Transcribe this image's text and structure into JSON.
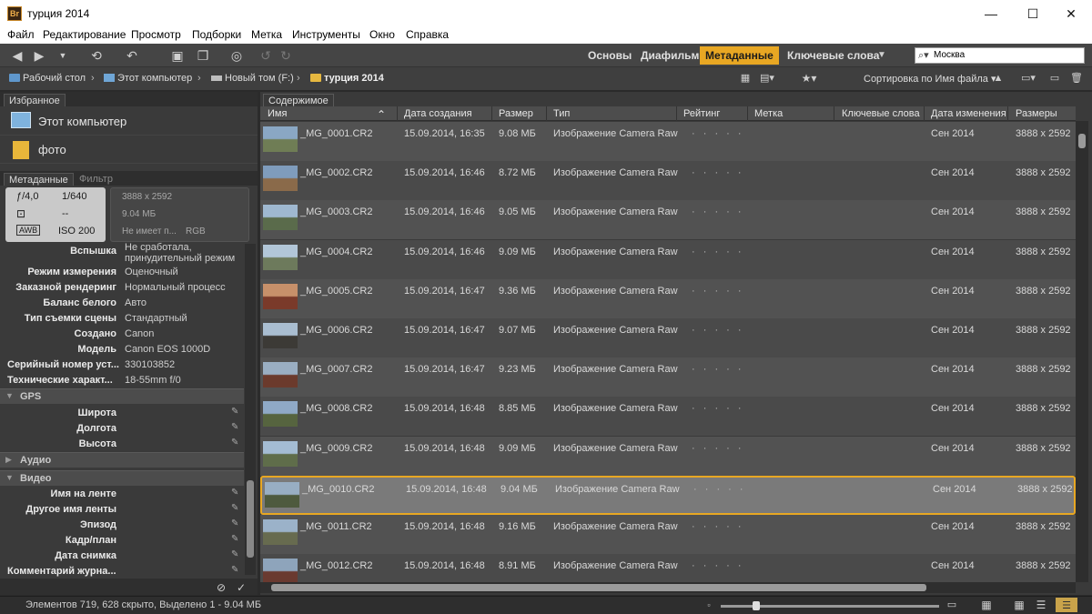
{
  "window": {
    "app_icon": "Br",
    "title": "турция 2014",
    "minimize": "—",
    "maximize": "☐",
    "close": "✕"
  },
  "menu": [
    "Файл",
    "Редактирование",
    "Просмотр",
    "Подборки",
    "Метка",
    "Инструменты",
    "Окно",
    "Справка"
  ],
  "workspaces": [
    {
      "label": "Основы",
      "active": false
    },
    {
      "label": "Диафильм",
      "active": false
    },
    {
      "label": "Метаданные",
      "active": true
    },
    {
      "label": "Ключевые слова",
      "active": false
    }
  ],
  "search": {
    "value": "Москва"
  },
  "breadcrumb": [
    "Рабочий стол",
    "Этот компьютер",
    "Новый том (F:)",
    "турция 2014"
  ],
  "sort": {
    "label": "Сортировка по Имя файла"
  },
  "favorites": {
    "tab_label": "Избранное",
    "items": [
      "Этот компьютер",
      "фото"
    ]
  },
  "metadata_panel": {
    "tabs": [
      "Метаданные",
      "Фильтр"
    ],
    "exif": {
      "aperture": "ƒ/4,0",
      "shutter": "1/640",
      "metering_value": "--",
      "wb": "AWB",
      "iso": "ISO 200"
    },
    "file_info": {
      "dimensions": "3888 x 2592",
      "size": "9.04 МБ",
      "profile": "Не имеет п...",
      "color_mode": "RGB"
    },
    "rows": [
      {
        "key": "Вспышка",
        "value": "Не сработала, принудительный режим"
      },
      {
        "key": "Режим измерения",
        "value": "Оценочный"
      },
      {
        "key": "Заказной рендеринг",
        "value": "Нормальный процесс"
      },
      {
        "key": "Баланс белого",
        "value": "Авто"
      },
      {
        "key": "Тип съемки сцены",
        "value": "Стандартный"
      },
      {
        "key": "Создано",
        "value": "Canon"
      },
      {
        "key": "Модель",
        "value": "Canon EOS 1000D"
      },
      {
        "key": "Серийный номер уст...",
        "value": "330103852"
      },
      {
        "key": "Технические характ...",
        "value": "18-55mm f/0"
      }
    ],
    "sections": {
      "gps": {
        "label": "GPS",
        "fields": [
          "Широта",
          "Долгота",
          "Высота"
        ]
      },
      "audio": {
        "label": "Аудио"
      },
      "video": {
        "label": "Видео",
        "fields": [
          "Имя на ленте",
          "Другое имя ленты",
          "Эпизод",
          "Кадр/план",
          "Дата снимка",
          "Комментарий журна..."
        ]
      }
    }
  },
  "content": {
    "tab_label": "Содержимое",
    "columns": [
      "Имя",
      "Дата создания",
      "Размер",
      "Тип",
      "Рейтинг",
      "Метка",
      "Ключевые слова",
      "Дата изменения",
      "Размеры"
    ],
    "files": [
      {
        "name": "_MG_0001.CR2",
        "created": "15.09.2014, 16:35",
        "size": "9.08 МБ",
        "type": "Изображение Camera Raw",
        "rating": "· · · · ·",
        "modified": "Сен 2014",
        "dims": "3888 x 2592",
        "thumb": [
          "#8aa7c4",
          "#6f7d55"
        ]
      },
      {
        "name": "_MG_0002.CR2",
        "created": "15.09.2014, 16:46",
        "size": "8.72 МБ",
        "type": "Изображение Camera Raw",
        "rating": "· · · · ·",
        "modified": "Сен 2014",
        "dims": "3888 x 2592",
        "thumb": [
          "#7f9cbc",
          "#8a6a4a"
        ]
      },
      {
        "name": "_MG_0003.CR2",
        "created": "15.09.2014, 16:46",
        "size": "9.05 МБ",
        "type": "Изображение Camera Raw",
        "rating": "· · · · ·",
        "modified": "Сен 2014",
        "dims": "3888 x 2592",
        "thumb": [
          "#9fb8d0",
          "#5a6b4b"
        ]
      },
      {
        "name": "_MG_0004.CR2",
        "created": "15.09.2014, 16:46",
        "size": "9.09 МБ",
        "type": "Изображение Camera Raw",
        "rating": "· · · · ·",
        "modified": "Сен 2014",
        "dims": "3888 x 2592",
        "thumb": [
          "#b2c6d8",
          "#6d7a5c"
        ]
      },
      {
        "name": "_MG_0005.CR2",
        "created": "15.09.2014, 16:47",
        "size": "9.36 МБ",
        "type": "Изображение Camera Raw",
        "rating": "· · · · ·",
        "modified": "Сен 2014",
        "dims": "3888 x 2592",
        "thumb": [
          "#c7906a",
          "#7a3a2a"
        ]
      },
      {
        "name": "_MG_0006.CR2",
        "created": "15.09.2014, 16:47",
        "size": "9.07 МБ",
        "type": "Изображение Camera Raw",
        "rating": "· · · · ·",
        "modified": "Сен 2014",
        "dims": "3888 x 2592",
        "thumb": [
          "#a9bdd0",
          "#3c3a36"
        ]
      },
      {
        "name": "_MG_0007.CR2",
        "created": "15.09.2014, 16:47",
        "size": "9.23 МБ",
        "type": "Изображение Camera Raw",
        "rating": "· · · · ·",
        "modified": "Сен 2014",
        "dims": "3888 x 2592",
        "thumb": [
          "#9aaec2",
          "#6b3a2c"
        ]
      },
      {
        "name": "_MG_0008.CR2",
        "created": "15.09.2014, 16:48",
        "size": "8.85 МБ",
        "type": "Изображение Camera Raw",
        "rating": "· · · · ·",
        "modified": "Сен 2014",
        "dims": "3888 x 2592",
        "thumb": [
          "#8fa9c6",
          "#56643f"
        ]
      },
      {
        "name": "_MG_0009.CR2",
        "created": "15.09.2014, 16:48",
        "size": "9.09 МБ",
        "type": "Изображение Camera Raw",
        "rating": "· · · · ·",
        "modified": "Сен 2014",
        "dims": "3888 x 2592",
        "thumb": [
          "#a4bcd3",
          "#5f6d4a"
        ]
      },
      {
        "name": "_MG_0010.CR2",
        "created": "15.09.2014, 16:48",
        "size": "9.04 МБ",
        "type": "Изображение Camera Raw",
        "rating": "· · · · ·",
        "modified": "Сен 2014",
        "dims": "3888 x 2592",
        "thumb": [
          "#98aec3",
          "#4e5a3e"
        ],
        "selected": true
      },
      {
        "name": "_MG_0011.CR2",
        "created": "15.09.2014, 16:48",
        "size": "9.16 МБ",
        "type": "Изображение Camera Raw",
        "rating": "· · · · ·",
        "modified": "Сен 2014",
        "dims": "3888 x 2592",
        "thumb": [
          "#9bb2c9",
          "#676b4f"
        ]
      },
      {
        "name": "_MG_0012.CR2",
        "created": "15.09.2014, 16:48",
        "size": "8.91 МБ",
        "type": "Изображение Camera Raw",
        "rating": "· · · · ·",
        "modified": "Сен 2014",
        "dims": "3888 x 2592",
        "thumb": [
          "#8ea4bb",
          "#6a3a30"
        ]
      }
    ]
  },
  "status": {
    "text": "Элементов 719, 628 скрыто, Выделено 1 - 9.04 МБ"
  },
  "colors": {
    "accent": "#e8a723",
    "panel": "#3a3a3a",
    "row_odd": "#525252",
    "row_even": "#4a4a4a"
  }
}
